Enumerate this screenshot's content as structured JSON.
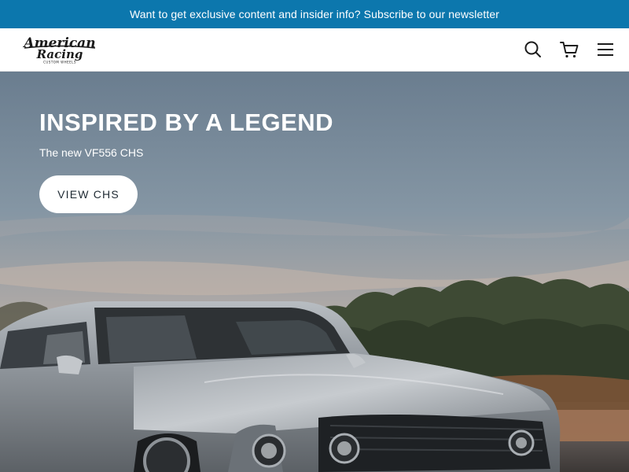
{
  "announcement": {
    "text": "Want to get exclusive content and insider info? Subscribe to our newsletter"
  },
  "header": {
    "logo": {
      "line1": "American",
      "line2": "Racing",
      "tagline": "CUSTOM WHEELS"
    },
    "icons": [
      "search-icon",
      "cart-icon",
      "hamburger-menu-icon"
    ]
  },
  "hero": {
    "title": "INSPIRED BY A LEGEND",
    "subtitle": "The new VF556 CHS",
    "cta_label": "VIEW CHS"
  },
  "colors": {
    "announcement_bg": "#0c77ad",
    "header_bg": "#ffffff",
    "hero_text": "#ffffff",
    "cta_bg": "#ffffff",
    "cta_text": "#1f2a33"
  }
}
